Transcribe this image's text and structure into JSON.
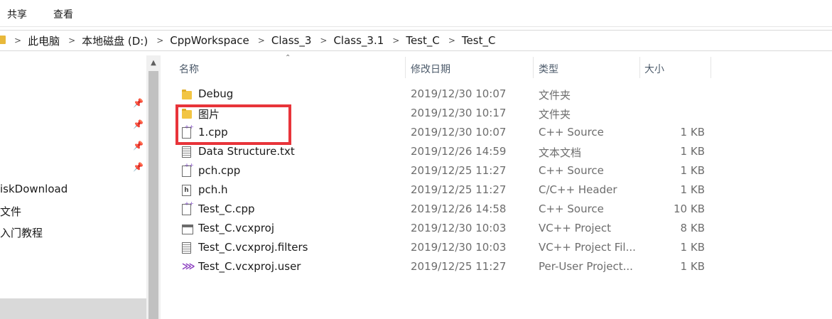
{
  "ribbon": {
    "tabs": [
      "共享",
      "查看"
    ]
  },
  "address_bar": {
    "separator": ">",
    "breadcrumbs": [
      "此电脑",
      "本地磁盘 (D:)",
      "CppWorkspace",
      "Class_3",
      "Class_3.1",
      "Test_C",
      "Test_C"
    ]
  },
  "nav_pane": {
    "items": [
      "iskDownload",
      "文件",
      "入门教程"
    ],
    "pin_icon": "pin-icon"
  },
  "columns": {
    "name": "名称",
    "date": "修改日期",
    "type": "类型",
    "size": "大小"
  },
  "files": [
    {
      "name": "Debug",
      "date": "2019/12/30 10:07",
      "type": "文件夹",
      "size": "",
      "icon": "folder-icon"
    },
    {
      "name": "图片",
      "date": "2019/12/30 10:17",
      "type": "文件夹",
      "size": "",
      "icon": "folder-icon"
    },
    {
      "name": "1.cpp",
      "date": "2019/12/30 10:07",
      "type": "C++ Source",
      "size": "1 KB",
      "icon": "cpp-file-icon"
    },
    {
      "name": "Data Structure.txt",
      "date": "2019/12/26 14:59",
      "type": "文本文档",
      "size": "1 KB",
      "icon": "text-file-icon"
    },
    {
      "name": "pch.cpp",
      "date": "2019/12/25 11:27",
      "type": "C++ Source",
      "size": "1 KB",
      "icon": "cpp-file-icon"
    },
    {
      "name": "pch.h",
      "date": "2019/12/25 11:27",
      "type": "C/C++ Header",
      "size": "1 KB",
      "icon": "header-file-icon"
    },
    {
      "name": "Test_C.cpp",
      "date": "2019/12/26 14:58",
      "type": "C++ Source",
      "size": "10 KB",
      "icon": "cpp-file-icon"
    },
    {
      "name": "Test_C.vcxproj",
      "date": "2019/12/30 10:03",
      "type": "VC++ Project",
      "size": "8 KB",
      "icon": "vcxproj-file-icon"
    },
    {
      "name": "Test_C.vcxproj.filters",
      "date": "2019/12/30 10:03",
      "type": "VC++ Project Fil...",
      "size": "1 KB",
      "icon": "filters-file-icon"
    },
    {
      "name": "Test_C.vcxproj.user",
      "date": "2019/12/25 11:27",
      "type": "Per-User Project...",
      "size": "1 KB",
      "icon": "user-project-file-icon"
    }
  ],
  "colors": {
    "highlight": "#e8343a",
    "folder": "#f2c543",
    "header_text": "#4d5b6b"
  }
}
